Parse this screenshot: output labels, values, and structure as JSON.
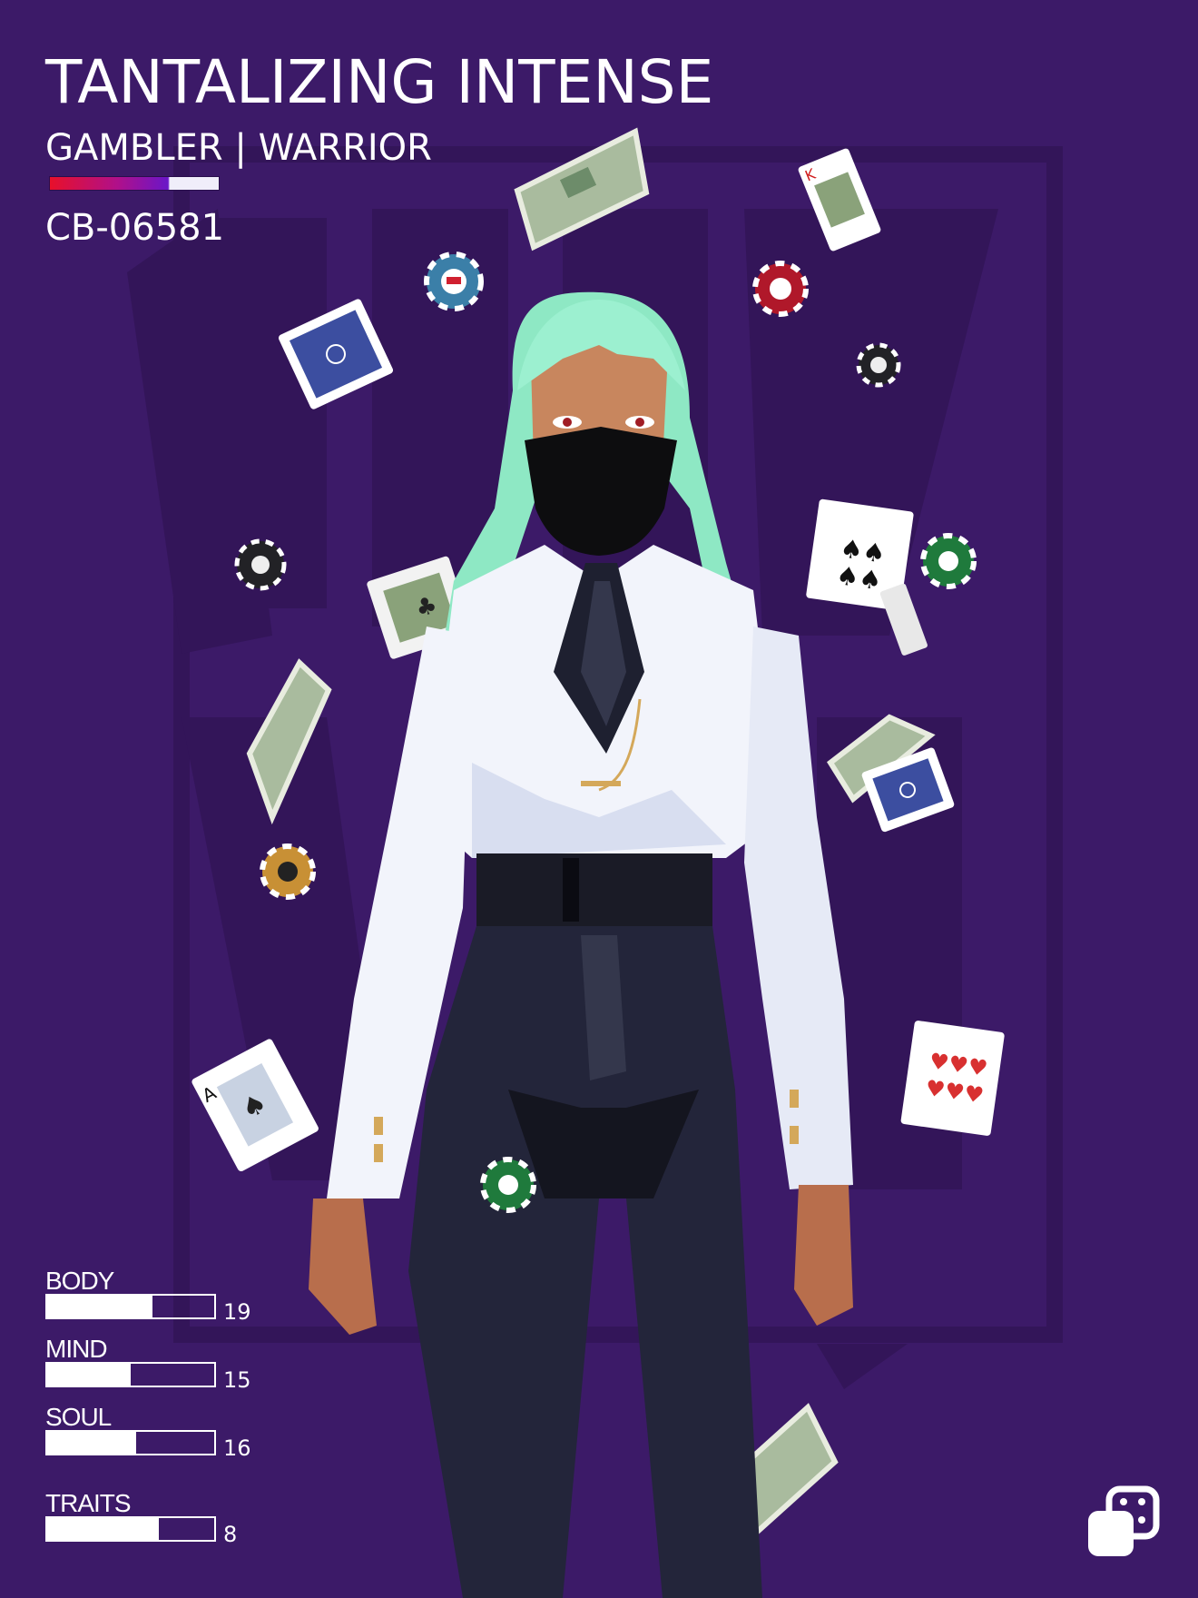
{
  "header": {
    "title": "TANTALIZING INTENSE",
    "subtitle": "GAMBLER | WARRIOR",
    "code": "CB-06581"
  },
  "background": {
    "color": "#3c1a68",
    "text_color": "#321459"
  },
  "stats": [
    {
      "label": "BODY",
      "value": "19",
      "level": 0.63
    },
    {
      "label": "MIND",
      "value": "15",
      "level": 0.5
    },
    {
      "label": "SOUL",
      "value": "16",
      "level": 0.53
    },
    {
      "label": "TRAITS",
      "value": "8",
      "level": 0.67
    }
  ],
  "character": {
    "hair_color": "#8ee8c4",
    "shirt_color": "#f2f4fb",
    "pants_color": "#23253a",
    "mask_color": "#0d0d0f"
  },
  "props": [
    "playing-card",
    "poker-chip",
    "banknote"
  ],
  "logo_icon": "dice-icon"
}
